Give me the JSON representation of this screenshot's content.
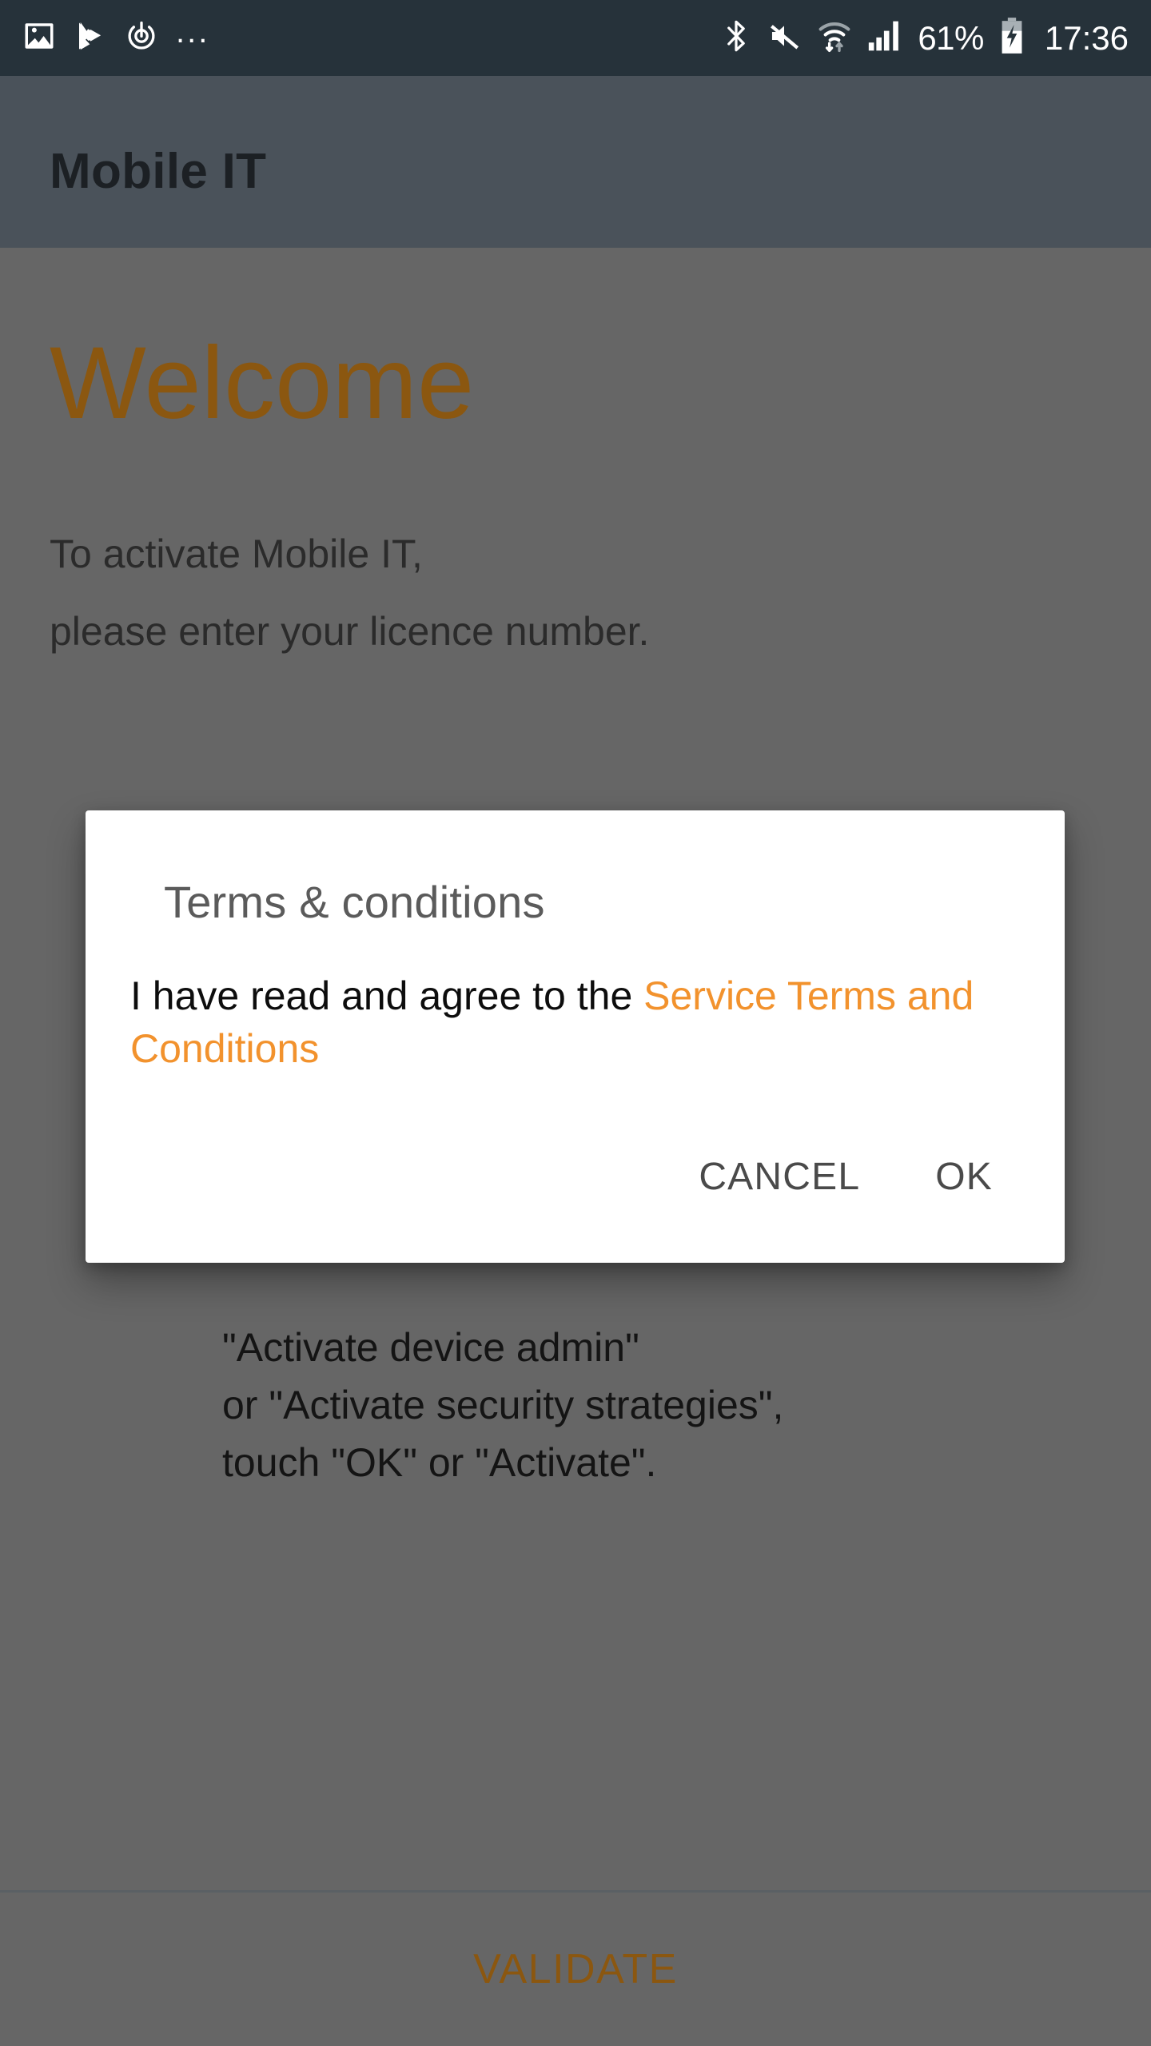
{
  "statusbar": {
    "left_icons": [
      "image-icon",
      "play-check-icon",
      "power-restart-icon"
    ],
    "overflow": "...",
    "right_icons": [
      "bluetooth-icon",
      "volume-mute-icon",
      "wifi-icon",
      "cellular-signal-icon",
      "battery-charging-icon"
    ],
    "battery_percent": "61%",
    "clock": "17:36",
    "background_color": "#26323a"
  },
  "actionbar": {
    "title": "Mobile IT",
    "background_color": "#4a525a"
  },
  "content": {
    "welcome_heading": "Welcome",
    "subtitle_line1": "To activate Mobile IT,",
    "subtitle_line2": "please enter your licence number.",
    "admin_note_line1": "\"Activate device admin\"",
    "admin_note_line2": "or \"Activate security strategies\",",
    "admin_note_line3": "touch \"OK\" or \"Activate\".",
    "accent_color_dimmed": "#8b5710"
  },
  "bottom_bar": {
    "validate_label": "VALIDATE"
  },
  "dialog": {
    "title": "Terms & conditions",
    "body_prefix": "I have read and agree to the ",
    "body_link": "Service Terms and Conditions",
    "link_color": "#f2922d",
    "cancel_label": "CANCEL",
    "ok_label": "OK"
  }
}
